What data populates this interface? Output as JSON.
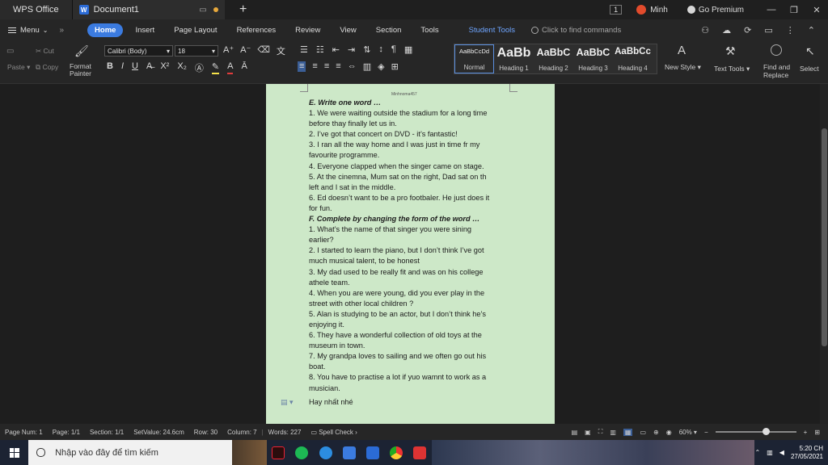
{
  "titlebar": {
    "app_name": "WPS Office",
    "doc_tab": "Document1",
    "new_tab": "+",
    "badge": "1",
    "user": "Minh",
    "go_premium": "Go Premium",
    "minimize": "—",
    "restore": "❐",
    "close": "✕"
  },
  "menubar": {
    "menu": "Menu",
    "tabs": [
      "Home",
      "Insert",
      "Page Layout",
      "References",
      "Review",
      "View",
      "Section",
      "Tools",
      "Student Tools"
    ],
    "search_placeholder": "Click to find commands"
  },
  "ribbon": {
    "paste": "Paste",
    "cut": "Cut",
    "copy": "Copy",
    "format_painter_1": "Format",
    "format_painter_2": "Painter",
    "font_name": "Calibri (Body)",
    "font_size": "18",
    "styles": [
      {
        "preview": "AaBbCcDd",
        "label": "Normal"
      },
      {
        "preview": "AaBb",
        "label": "Heading 1"
      },
      {
        "preview": "AaBbC",
        "label": "Heading 2"
      },
      {
        "preview": "AaBbC",
        "label": "Heading 3"
      },
      {
        "preview": "AaBbCc",
        "label": "Heading 4"
      }
    ],
    "new_style": "New Style",
    "text_tools": "Text Tools",
    "find_replace_1": "Find and",
    "find_replace_2": "Replace",
    "select": "Select"
  },
  "document": {
    "header_tag": "Minhnoma457",
    "lines": [
      {
        "text": "E. Write one word …",
        "style": "head"
      },
      {
        "text": "1. We were waiting outside the stadium for a long time",
        "style": ""
      },
      {
        "text": "before thay finally let us in.",
        "style": ""
      },
      {
        "text": "2. I’ve got that concert on DVD - it’s fantastic!",
        "style": ""
      },
      {
        "text": "3. I ran all the way home and I was just  in time fr my",
        "style": ""
      },
      {
        "text": "favourite programme.",
        "style": ""
      },
      {
        "text": "4. Everyone clapped when the singer came on stage.",
        "style": ""
      },
      {
        "text": "5. At the cinemna, Mum sat on the right, Dad sat on th",
        "style": ""
      },
      {
        "text": "left and I sat in the middle.",
        "style": ""
      },
      {
        "text": "6. Ed doesn’t want to be a pro footbaler. He just does it",
        "style": ""
      },
      {
        "text": "for  fun.",
        "style": ""
      },
      {
        "text": "F. Complete by changing the form of the word …",
        "style": "head"
      },
      {
        "text": "1. What’s the name of that  singer you were sining",
        "style": ""
      },
      {
        "text": "earlier?",
        "style": ""
      },
      {
        "text": "2. I started to learn the piano, but I don’t think I’ve got",
        "style": ""
      },
      {
        "text": "much musical talent, to be honest",
        "style": ""
      },
      {
        "text": "3. My dad used to be really fit and was on his college",
        "style": ""
      },
      {
        "text": "athele team.",
        "style": ""
      },
      {
        "text": "4. When you are were young, did you ever play in the",
        "style": ""
      },
      {
        "text": "street with other local children ?",
        "style": ""
      },
      {
        "text": "5. Alan is studying to be an actor, but I don’t think he’s",
        "style": ""
      },
      {
        "text": "enjoying it.",
        "style": ""
      },
      {
        "text": "6. They have a wonderful collection of old toys at the",
        "style": ""
      },
      {
        "text": "museum in town.",
        "style": ""
      },
      {
        "text": "7. My grandpa loves to sailing and we often go out his",
        "style": ""
      },
      {
        "text": "boat.",
        "style": ""
      },
      {
        "text": "8. You have to practise a lot if yuo wamnt to work as a",
        "style": ""
      },
      {
        "text": "musician.",
        "style": ""
      },
      {
        "text": "Hay nhất nhé",
        "style": "last"
      }
    ]
  },
  "statusbar": {
    "page_num": "Page Num: 1",
    "page": "Page: 1/1",
    "section": "Section: 1/1",
    "set_value": "SetValue: 24.6cm",
    "row": "Row: 30",
    "column": "Column: 7",
    "words": "Words: 227",
    "spell_check": "Spell Check",
    "zoom": "60%",
    "zoom_fraction": 0.62
  },
  "taskbar": {
    "search_placeholder": "Nhập vào đây để tìm kiếm",
    "time": "5:20 CH",
    "date": "27/05/2021"
  },
  "colors": {
    "page_bg": "#cde8c8",
    "accent": "#3b7be0"
  }
}
